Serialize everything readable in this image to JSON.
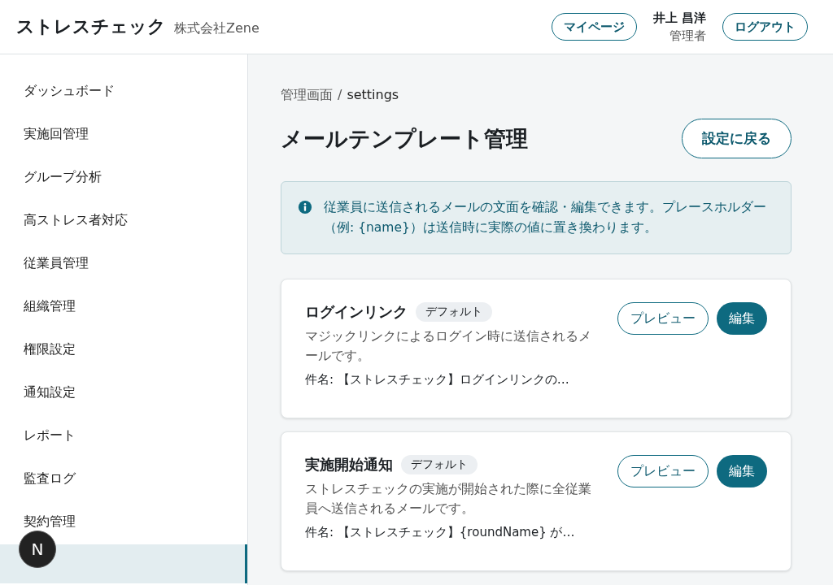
{
  "header": {
    "app_title": "ストレスチェック",
    "company": "株式会社Zene",
    "mypage_button": "マイページ",
    "user_name": "井上 昌洋",
    "user_role": "管理者",
    "logout_button": "ログアウト"
  },
  "sidebar": {
    "items": [
      {
        "label": "ダッシュボード",
        "selected": false
      },
      {
        "label": "実施回管理",
        "selected": false
      },
      {
        "label": "グループ分析",
        "selected": false
      },
      {
        "label": "高ストレス者対応",
        "selected": false
      },
      {
        "label": "従業員管理",
        "selected": false
      },
      {
        "label": "組織管理",
        "selected": false
      },
      {
        "label": "権限設定",
        "selected": false
      },
      {
        "label": "通知設定",
        "selected": false
      },
      {
        "label": "レポート",
        "selected": false
      },
      {
        "label": "監査ログ",
        "selected": false
      },
      {
        "label": "契約管理",
        "selected": false
      },
      {
        "selected": true
      }
    ]
  },
  "dev_badge": "N",
  "breadcrumb": {
    "parent": "管理画面",
    "separator": "/",
    "current": "settings"
  },
  "page_title": "メールテンプレート管理",
  "back_button": "設定に戻る",
  "info_notice": "従業員に送信されるメールの文面を確認・編集できます。プレースホルダー（例: {name}）は送信時に実際の値に置き換わります。",
  "templates": [
    {
      "name": "ログインリンク",
      "badge": "デフォルト",
      "description": "マジックリンクによるログイン時に送信されるメールです。",
      "subject": "件名: 【ストレスチェック】ログインリンクの…",
      "preview_button": "プレビュー",
      "edit_button": "編集"
    },
    {
      "name": "実施開始通知",
      "badge": "デフォルト",
      "description": "ストレスチェックの実施が開始された際に全従業員へ送信されるメールです。",
      "subject": "件名: 【ストレスチェック】{roundName} が…",
      "preview_button": "プレビュー",
      "edit_button": "編集"
    }
  ]
}
